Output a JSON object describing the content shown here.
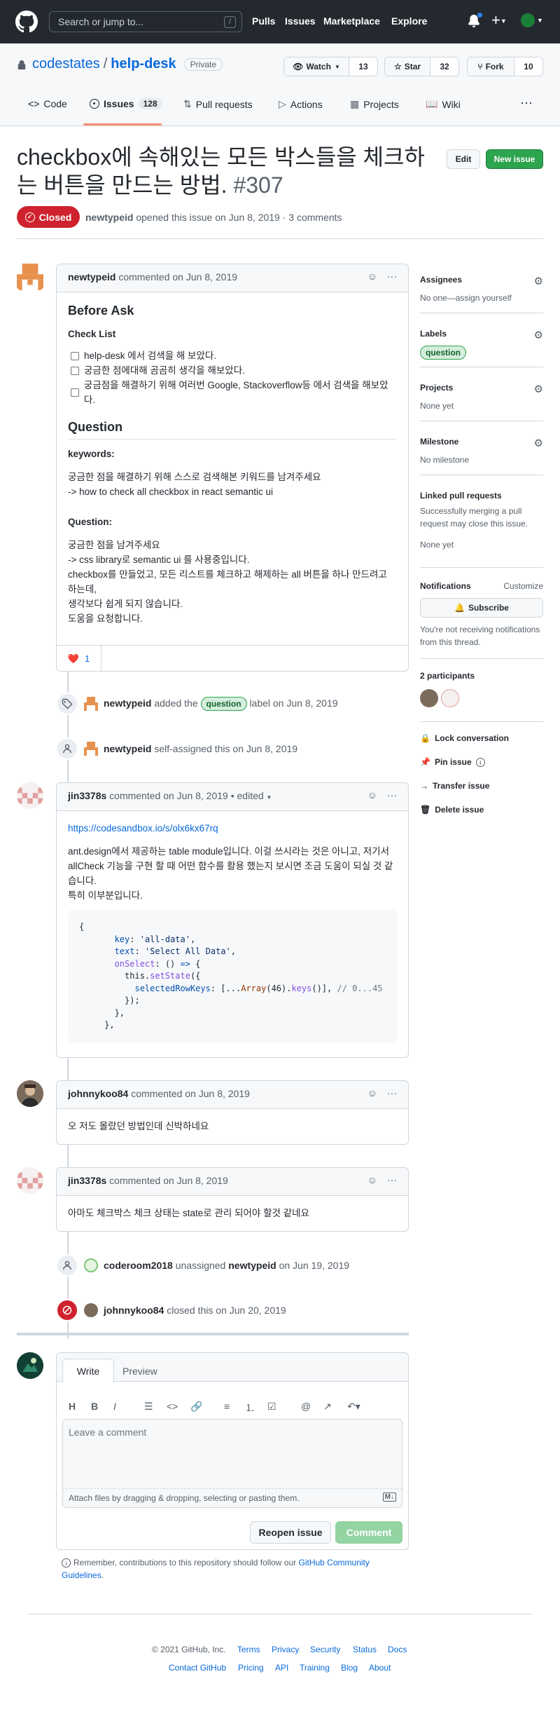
{
  "header": {
    "search_placeholder": "Search or jump to...",
    "slash": "/",
    "nav": [
      "Pulls",
      "Issues",
      "Marketplace",
      "Explore"
    ]
  },
  "repo": {
    "owner": "codestates",
    "sep": "/",
    "name": "help-desk",
    "visibility": "Private",
    "watch_label": "Watch",
    "watch_count": "13",
    "star_label": "Star",
    "star_count": "32",
    "fork_label": "Fork",
    "fork_count": "10",
    "tabs": {
      "code": "Code",
      "issues": "Issues",
      "issues_count": "128",
      "pulls": "Pull requests",
      "actions": "Actions",
      "projects": "Projects",
      "wiki": "Wiki"
    }
  },
  "issue": {
    "title": "checkbox에 속해있는 모든 박스들을 체크하는 버튼을 만드는 방법.",
    "number": "#307",
    "edit_label": "Edit",
    "new_issue_label": "New issue",
    "state": "Closed",
    "author": "newtypeid",
    "meta": "opened this issue on Jun 8, 2019 · 3 comments"
  },
  "first_comment": {
    "author": "newtypeid",
    "meta": "commented on Jun 8, 2019",
    "h_before": "Before Ask",
    "h_checklist": "Check List",
    "checks": [
      "help-desk 에서 검색을 해 보았다.",
      "궁금한 점에대해 곰곰히 생각을 해보았다.",
      "궁금점을 해결하기 위해 여러번 Google, Stackoverflow등 에서 검색을 해보았다."
    ],
    "h_question": "Question",
    "h_keywords": "keywords:",
    "keywords_l1": "궁금한 점을 해결하기 위해 스스로 검색해본 키워드를 남겨주세요",
    "keywords_l2": "-> how to check all checkbox in react semantic ui",
    "h_question2": "Question:",
    "q_l1": "궁금한 점을 남겨주세요",
    "q_l2": "-> css library로 semantic ui 를 사용중입니다.",
    "q_l3": "checkbox를 만들었고, 모든 리스트를 체크하고 해제하는 all 버튼을 하나 만드려고 하는데,",
    "q_l4": "생각보다 쉽게 되지 않습니다.",
    "q_l5": "도움을 요청합니다.",
    "reaction_emoji": "❤️",
    "reaction_count": "1"
  },
  "event_label": {
    "actor": "newtypeid",
    "pre": "added the",
    "label": "question",
    "post": "label on Jun 8, 2019"
  },
  "event_assign": {
    "actor": "newtypeid",
    "text": "self-assigned this on Jun 8, 2019"
  },
  "comment2": {
    "author": "jin3378s",
    "meta": "commented on Jun 8, 2019 • edited",
    "link": "https://codesandbox.io/s/olx6kx67rq",
    "p1": "ant.design에서 제공하는 table module입니다. 이걸 쓰시라는 것은 아니고, 저기서 allCheck 기능을 구현 할 때 어떤 함수를 활용 했는지 보시면 조금 도움이 되실 것 같습니다.",
    "p2": "특히 이부분입니다.",
    "code": "{\n       key: 'all-data',\n       text: 'Select All Data',\n       onSelect: () => {\n         this.setState({\n           selectedRowKeys: [...Array(46).keys()], // 0...45\n         });\n       },\n     },"
  },
  "comment3": {
    "author": "johnnykoo84",
    "meta": "commented on Jun 8, 2019",
    "body": "오 저도 몰랐던 방법인데 신박하네요"
  },
  "comment4": {
    "author": "jin3378s",
    "meta": "commented on Jun 8, 2019",
    "body": "아마도 체크박스 체크 상태는 state로 관리 되어야 할것 같네요"
  },
  "event_unassign": {
    "actor": "coderoom2018",
    "mid": "unassigned",
    "target": "newtypeid",
    "post": "on Jun 19, 2019"
  },
  "event_closed": {
    "actor": "johnnykoo84",
    "text": "closed this on Jun 20, 2019"
  },
  "composer": {
    "tab_write": "Write",
    "tab_preview": "Preview",
    "placeholder": "Leave a comment",
    "attach_hint": "Attach files by dragging & dropping, selecting or pasting them.",
    "reopen_label": "Reopen issue",
    "comment_label": "Comment",
    "remember_text": "Remember, contributions to this repository should follow our",
    "guidelines_link": "GitHub Community Guidelines",
    "period": "."
  },
  "sidebar": {
    "assignees_h": "Assignees",
    "assignees_v": "No one—assign yourself",
    "labels_h": "Labels",
    "labels_v": "question",
    "projects_h": "Projects",
    "projects_v": "None yet",
    "milestone_h": "Milestone",
    "milestone_v": "No milestone",
    "linked_h": "Linked pull requests",
    "linked_desc": "Successfully merging a pull request may close this issue.",
    "linked_v": "None yet",
    "notif_h": "Notifications",
    "customize": "Customize",
    "subscribe": "Subscribe",
    "notif_desc": "You're not receiving notifications from this thread.",
    "participants": "2 participants",
    "lock": "Lock conversation",
    "pin": "Pin issue",
    "transfer": "Transfer issue",
    "delete": "Delete issue"
  },
  "footer": {
    "copyright": "© 2021 GitHub, Inc.",
    "row1": [
      "Terms",
      "Privacy",
      "Security",
      "Status",
      "Docs"
    ],
    "row2": [
      "Contact GitHub",
      "Pricing",
      "API",
      "Training",
      "Blog",
      "About"
    ]
  },
  "colors": {
    "accent": "#0969da",
    "closed": "#cf222e",
    "green": "#2da44e",
    "topbar": "#24292f"
  }
}
